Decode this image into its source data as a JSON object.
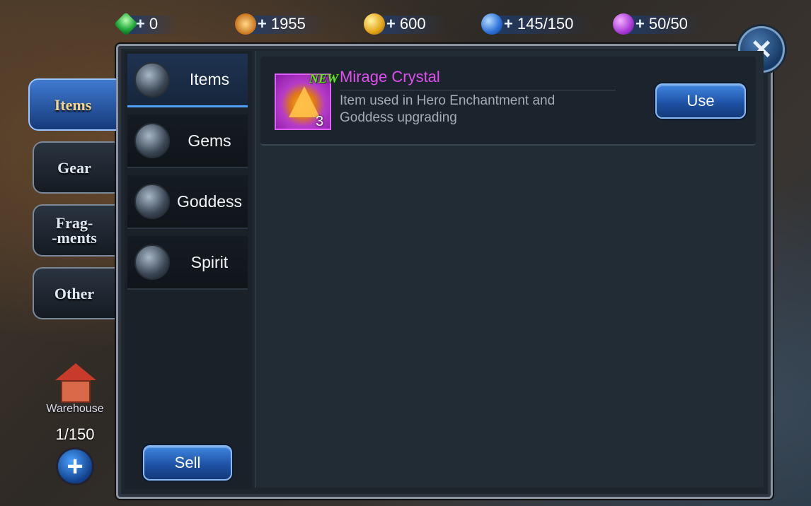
{
  "resources": [
    {
      "name": "gems",
      "icon": "gem-icon",
      "value": "0"
    },
    {
      "name": "power",
      "icon": "pwr-icon",
      "value": "1955"
    },
    {
      "name": "gold",
      "icon": "gold-coin-icon",
      "value": "600"
    },
    {
      "name": "stamina",
      "icon": "stamina-icon",
      "value": "145/150"
    },
    {
      "name": "energy",
      "icon": "energy-icon",
      "value": "50/50"
    }
  ],
  "plus_symbol": "+",
  "close_symbol": "✕",
  "categories": [
    "Items",
    "Gear",
    "Frag-\n-ments",
    "Other"
  ],
  "active_category": "Items",
  "subtabs": [
    "Items",
    "Gems",
    "Goddess",
    "Spirit"
  ],
  "active_subtab": "Items",
  "item": {
    "badge": "NEW",
    "name": "Mirage Crystal",
    "description": "Item used in Hero Enchantment and Goddess upgrading",
    "quantity": "3",
    "use_label": "Use"
  },
  "sell_label": "Sell",
  "warehouse": {
    "label": "Warehouse",
    "count": "1/150",
    "add_symbol": "+"
  },
  "colors": {
    "accent_blue": "#2a6ad0",
    "item_name": "#e04ef0",
    "new_badge": "#6fe020",
    "active_tab_text": "#f3d48a"
  }
}
